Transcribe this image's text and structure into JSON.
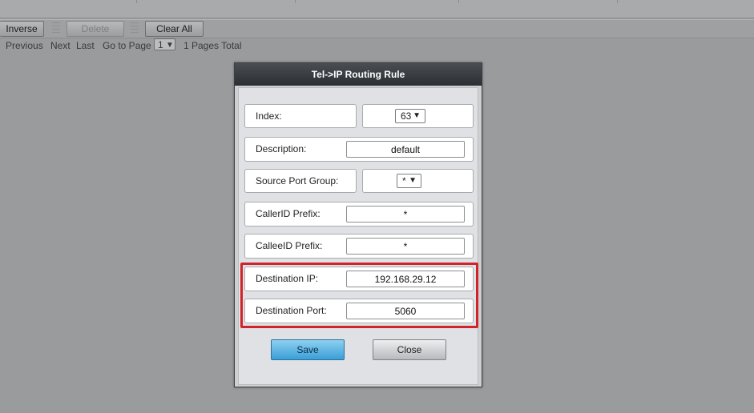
{
  "toolbar": {
    "inverse_label": "Inverse",
    "delete_label": "Delete",
    "clear_all_label": "Clear All"
  },
  "pager": {
    "previous": "Previous",
    "next": "Next",
    "last": "Last",
    "go_to_page": "Go to Page",
    "page_value": "1",
    "pages_total": "1 Pages Total"
  },
  "dialog": {
    "title": "Tel->IP Routing Rule",
    "fields": {
      "index_label": "Index:",
      "index_value": "63",
      "description_label": "Description:",
      "description_value": "default",
      "source_port_group_label": "Source Port Group:",
      "source_port_group_value": "*",
      "callerid_prefix_label": "CallerID Prefix:",
      "callerid_prefix_value": "*",
      "calleeid_prefix_label": "CalleeID Prefix:",
      "calleeid_prefix_value": "*",
      "destination_ip_label": "Destination IP:",
      "destination_ip_value": "192.168.29.12",
      "destination_port_label": "Destination Port:",
      "destination_port_value": "5060"
    },
    "save_label": "Save",
    "close_label": "Close"
  },
  "colors": {
    "highlight": "#d2232a",
    "save_button": "#3a9fd8",
    "title_bar": "#2b2e32"
  },
  "icons": {
    "dropdown_arrow": "chevron-down-icon",
    "separator": "grip-icon"
  }
}
